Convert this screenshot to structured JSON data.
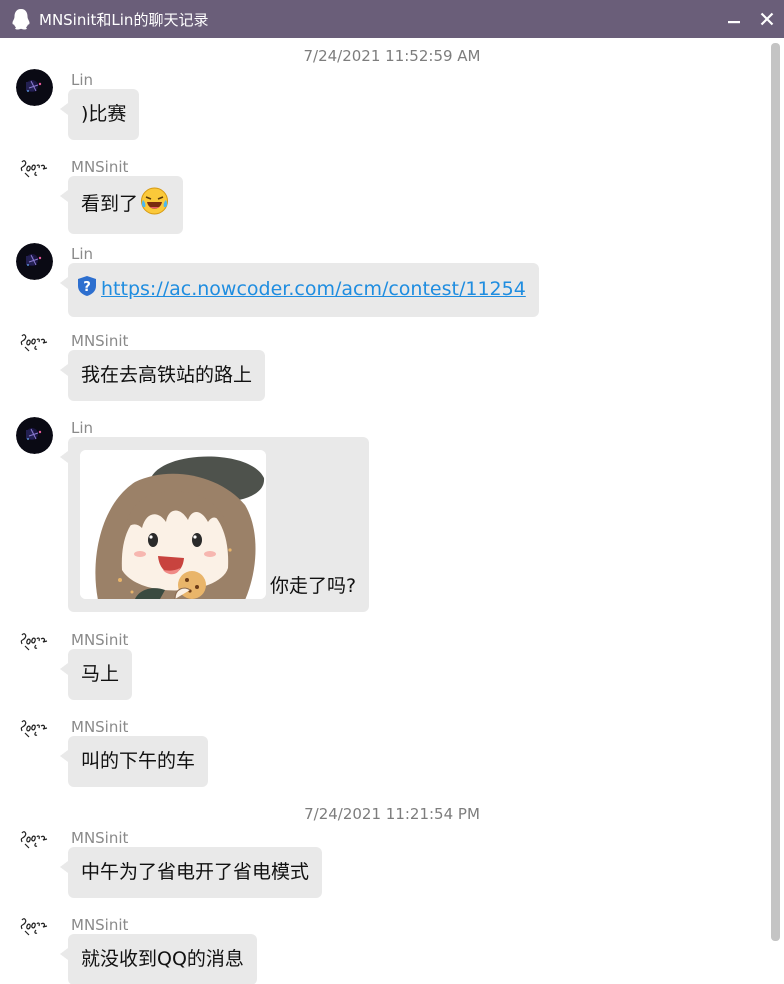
{
  "window": {
    "title": "MNSinit和Lin的聊天记录"
  },
  "timestamps": [
    "7/24/2021 11:52:59 AM",
    "7/24/2021 11:21:54 PM"
  ],
  "messages": [
    {
      "sender": "Lin",
      "text": ")比赛"
    },
    {
      "sender": "MNSinit",
      "text": "看到了",
      "emoji": "grinning-tears-emoji"
    },
    {
      "sender": "Lin",
      "link": "https://ac.nowcoder.com/acm/contest/11254",
      "icon": "shield-question-icon"
    },
    {
      "sender": "MNSinit",
      "text": "我在去高铁站的路上"
    },
    {
      "sender": "Lin",
      "text": "你走了吗?",
      "image": "anime-girl-eating-cookie-sticker"
    },
    {
      "sender": "MNSinit",
      "text": "马上"
    },
    {
      "sender": "MNSinit",
      "text": "叫的下午的车"
    },
    {
      "sender": "MNSinit",
      "text": "中午为了省电开了省电模式"
    },
    {
      "sender": "MNSinit",
      "text": "就没收到QQ的消息"
    }
  ],
  "colors": {
    "titlebar": "#6a5e79",
    "bubble": "#e9e9e9",
    "link": "#1f8de0",
    "timestamp": "#7d7d7d",
    "sender": "#8a8a8a"
  }
}
